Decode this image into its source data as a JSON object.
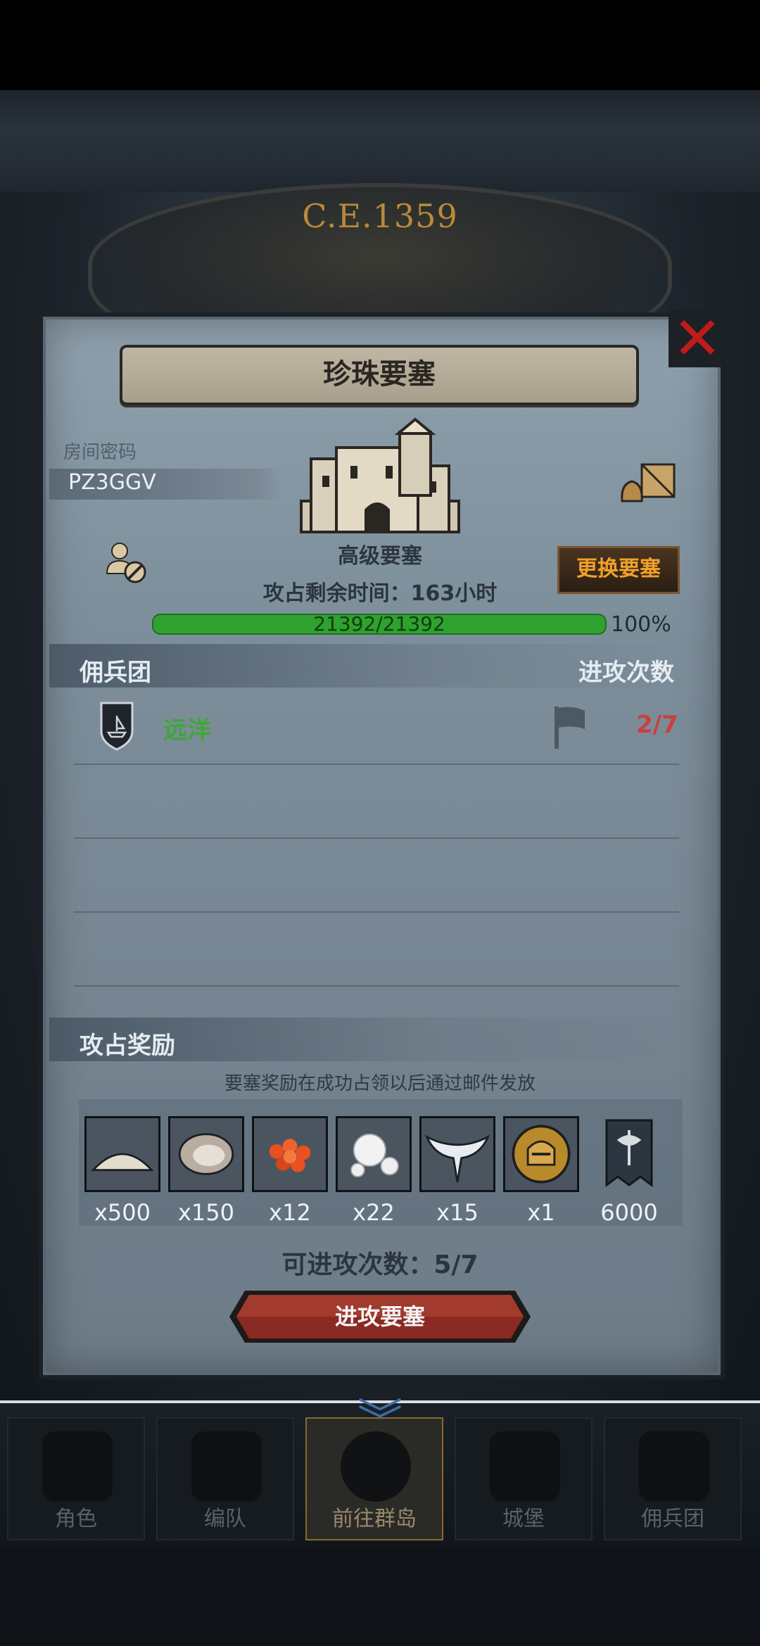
{
  "background": {
    "era": "C.E.1359"
  },
  "nav": {
    "tabs": [
      {
        "label": "角色"
      },
      {
        "label": "编队"
      },
      {
        "label": "前往群岛"
      },
      {
        "label": "城堡"
      },
      {
        "label": "佣兵团"
      }
    ]
  },
  "dialog": {
    "title": "珍珠要塞",
    "room_label": "房间密码",
    "room_code": "PZ3GGV",
    "fortress_type": "高级要塞",
    "remaining_time": "攻占剩余时间：163小时",
    "swap_button": "更换要塞",
    "hp": {
      "text": "21392/21392",
      "current": 21392,
      "max": 21392,
      "percent_label": "100%"
    },
    "mercenary_header": "佣兵团",
    "attack_count_header": "进攻次数",
    "teams": [
      {
        "name": "远洋",
        "attacks": "2/7"
      }
    ],
    "reward_header": "攻占奖励",
    "reward_note": "要塞奖励在成功占领以后通过邮件发放",
    "rewards": [
      {
        "icon": "salt-pile-icon",
        "qty": "x500"
      },
      {
        "icon": "oyster-icon",
        "qty": "x150"
      },
      {
        "icon": "fish-roe-icon",
        "qty": "x12"
      },
      {
        "icon": "pearls-icon",
        "qty": "x22"
      },
      {
        "icon": "winged-blade-icon",
        "qty": "x15"
      },
      {
        "icon": "knight-helmet-coin-icon",
        "qty": "x1"
      },
      {
        "icon": "guild-banner-icon",
        "qty": "6000"
      }
    ],
    "remaining_attacks": "可进攻次数：5/7",
    "attack_button": "进攻要塞"
  },
  "colors": {
    "hp_green": "#2fa12f",
    "team_green": "#3ea837",
    "attack_red": "#c8413f",
    "swap_orange": "#f2a02a",
    "close_red": "#c01a1a"
  }
}
